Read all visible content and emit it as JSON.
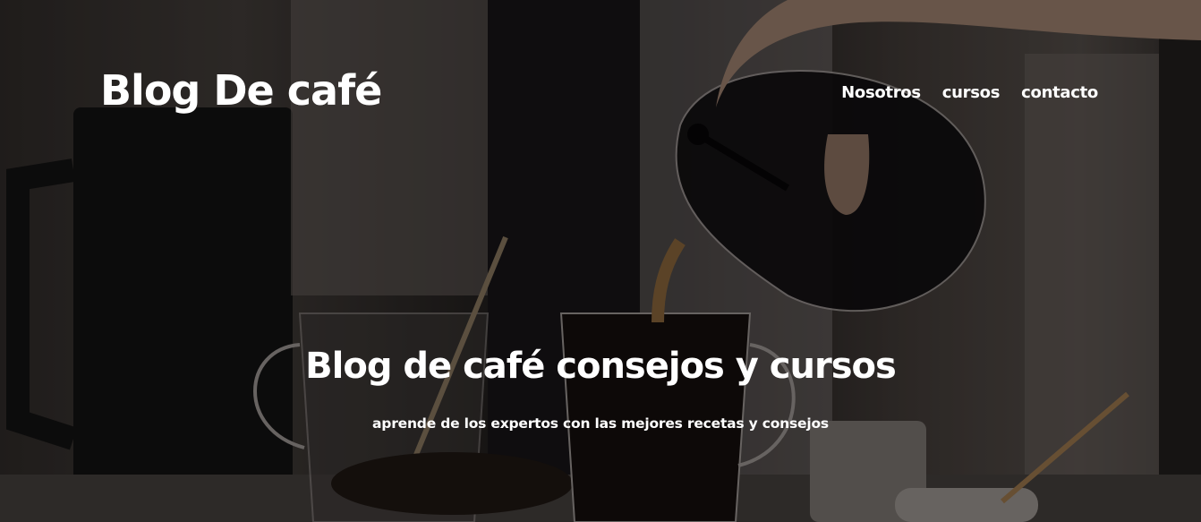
{
  "header": {
    "logo": "Blog De café",
    "nav": [
      "Nosotros",
      "cursos",
      "contacto"
    ]
  },
  "hero": {
    "title": "Blog de café consejos y cursos",
    "subtitle": "aprende de los expertos con las mejores recetas y consejos"
  },
  "colors": {
    "text": "#ffffff",
    "overlay": "#000000"
  }
}
